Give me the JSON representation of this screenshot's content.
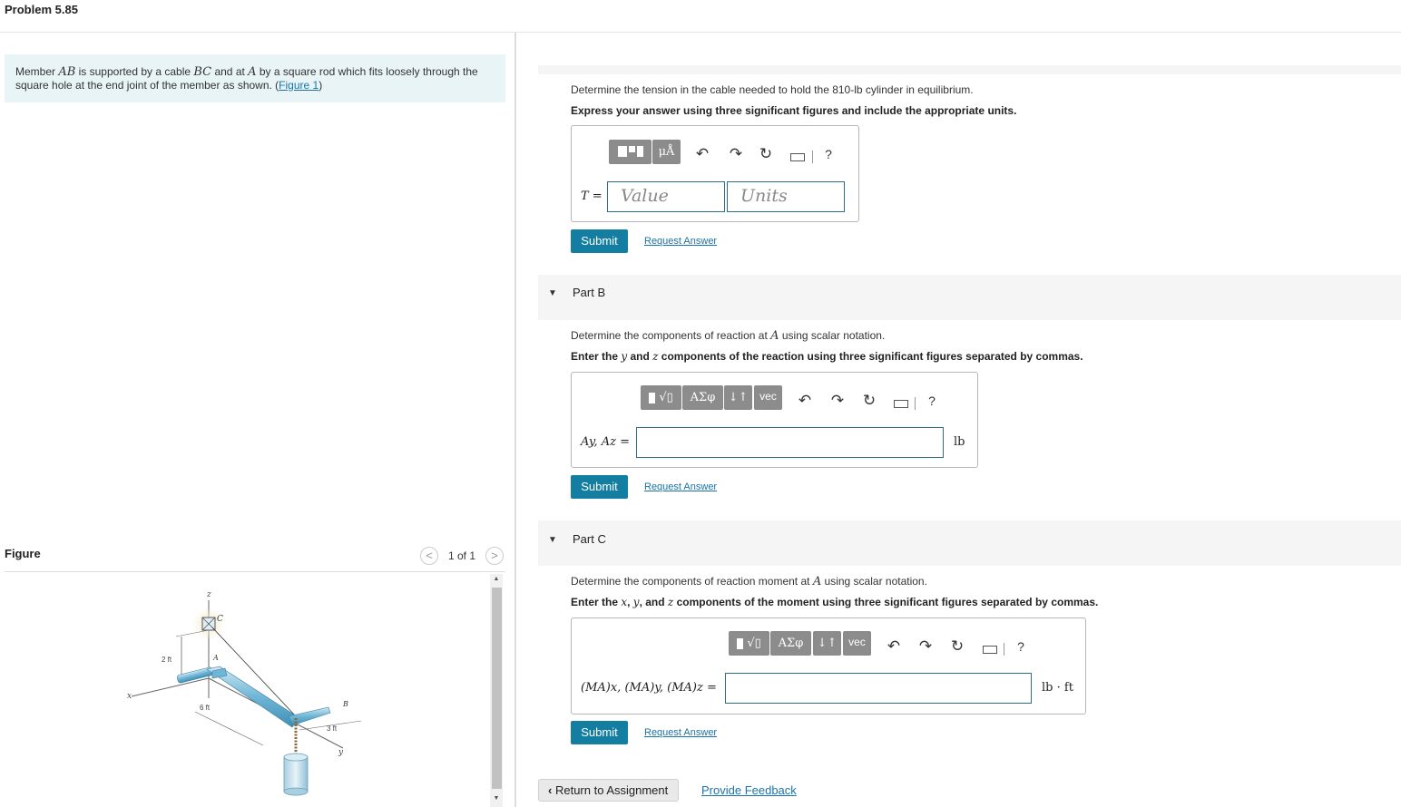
{
  "problem_title": "Problem 5.85",
  "statement": {
    "p1": "Member ",
    "v1": "AB",
    "p2": " is supported by a cable ",
    "v2": "BC",
    "p3": " and at ",
    "v3": "A",
    "p4": " by a square rod which fits loosely through the",
    "line2": "square hole at the end joint of the member as shown. (",
    "figure_link": "Figure 1",
    "close": ")"
  },
  "figure": {
    "label": "Figure",
    "prev": "<",
    "next": ">",
    "pager": "1 of 1",
    "labels": {
      "z": "z",
      "c": "C",
      "a": "A",
      "x": "x",
      "b": "B",
      "y": "y",
      "h": "2 ft",
      "l": "6 ft",
      "w": "3 ft"
    }
  },
  "part_a": {
    "question": "Determine the tension in the cable needed to hold the 810-lb cylinder in equilibrium.",
    "instruction": "Express your answer using three significant figures and include the appropriate units.",
    "toolbar": {
      "units_btn": "μÅ",
      "help": "?"
    },
    "eq_label": "T =",
    "value_placeholder": "Value",
    "units_placeholder": "Units",
    "submit": "Submit",
    "request": "Request Answer"
  },
  "part_b": {
    "title": "Part B",
    "q1": "Determine the components of reaction at ",
    "q1_var": "A",
    "q1_end": " using scalar notation.",
    "i1": "Enter the ",
    "i1_y": "y",
    "i1_and": " and ",
    "i1_z": "z",
    "i1_end": " components of the reaction using three significant figures separated by commas.",
    "toolbar": {
      "greek": "ΑΣφ",
      "arrows": "↓↑",
      "vec": "vec",
      "help": "?"
    },
    "eq_label": "Ay, Az =",
    "unit": "lb",
    "submit": "Submit",
    "request": "Request Answer"
  },
  "part_c": {
    "title": "Part C",
    "q1": "Determine the components of reaction moment at ",
    "q1_var": "A",
    "q1_end": " using scalar notation.",
    "i1": "Enter the ",
    "i1_x": "x",
    "i1_c1": ", ",
    "i1_y": "y",
    "i1_and": ", and ",
    "i1_z": "z",
    "i1_end": " components of the moment using three significant figures separated by commas.",
    "toolbar": {
      "greek": "ΑΣφ",
      "arrows": "↓↑",
      "vec": "vec",
      "help": "?"
    },
    "eq_label": "(MA)x, (MA)y, (MA)z =",
    "unit": "lb · ft",
    "submit": "Submit",
    "request": "Request Answer"
  },
  "footer": {
    "return": "Return to Assignment",
    "feedback": "Provide Feedback"
  },
  "colors": {
    "accent": "#137ea1",
    "link": "#1a73a8",
    "statement_bg": "#e8f4f6"
  }
}
